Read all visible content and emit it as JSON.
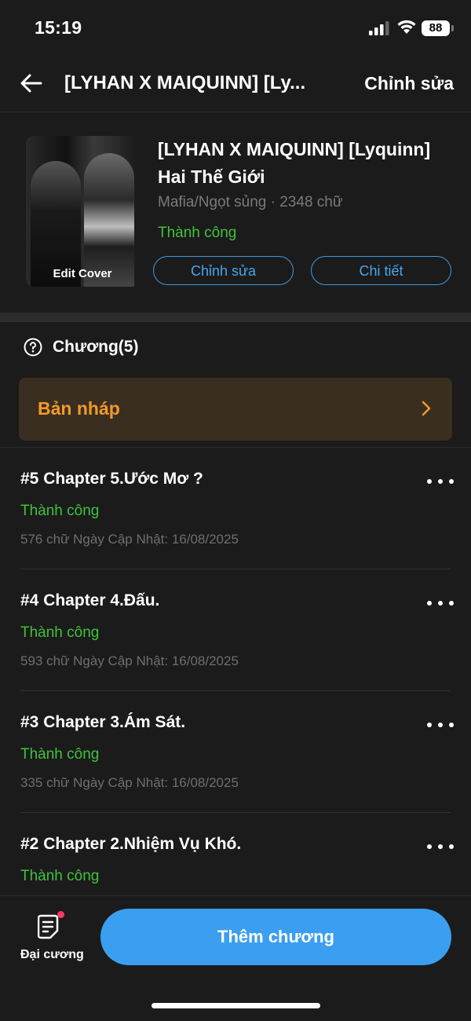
{
  "status_bar": {
    "time": "15:19",
    "battery": "88"
  },
  "nav": {
    "title": "[LYHAN X MAIQUINN] [Ly...",
    "edit_label": "Chỉnh sửa"
  },
  "book": {
    "title": "[LYHAN X MAIQUINN] [Lyquinn] Hai Thế Giới",
    "meta": "Mafia/Ngọt sủng · 2348 chữ",
    "status": "Thành công",
    "cover_label": "Edit Cover",
    "edit_button": "Chỉnh sửa",
    "detail_button": "Chi tiết"
  },
  "chapters_header": {
    "label": "Chương(5)"
  },
  "draft": {
    "label": "Bản nháp"
  },
  "chapters": [
    {
      "title": "#5 Chapter 5.Ước Mơ ?",
      "status": "Thành công",
      "meta": "576 chữ Ngày Cập Nhật: 16/08/2025"
    },
    {
      "title": "#4 Chapter 4.Đấu.",
      "status": "Thành công",
      "meta": "593 chữ Ngày Cập Nhật: 16/08/2025"
    },
    {
      "title": "#3 Chapter 3.Ám Sát.",
      "status": "Thành công",
      "meta": "335 chữ Ngày Cập Nhật: 16/08/2025"
    },
    {
      "title": "#2 Chapter 2.Nhiệm Vụ Khó.",
      "status": "Thành công",
      "meta": ""
    }
  ],
  "bottom": {
    "outline_label": "Đại cương",
    "add_chapter_label": "Thêm chương"
  },
  "colors": {
    "accent_blue": "#3a9ff0",
    "success_green": "#3fc23a",
    "draft_orange": "#f39a2a",
    "background": "#1b1b1b"
  },
  "icons": [
    "back-arrow-icon",
    "help-circle-icon",
    "chevron-right-icon",
    "more-dots-icon",
    "outline-document-icon",
    "signal-icon",
    "wifi-icon",
    "battery-icon"
  ]
}
